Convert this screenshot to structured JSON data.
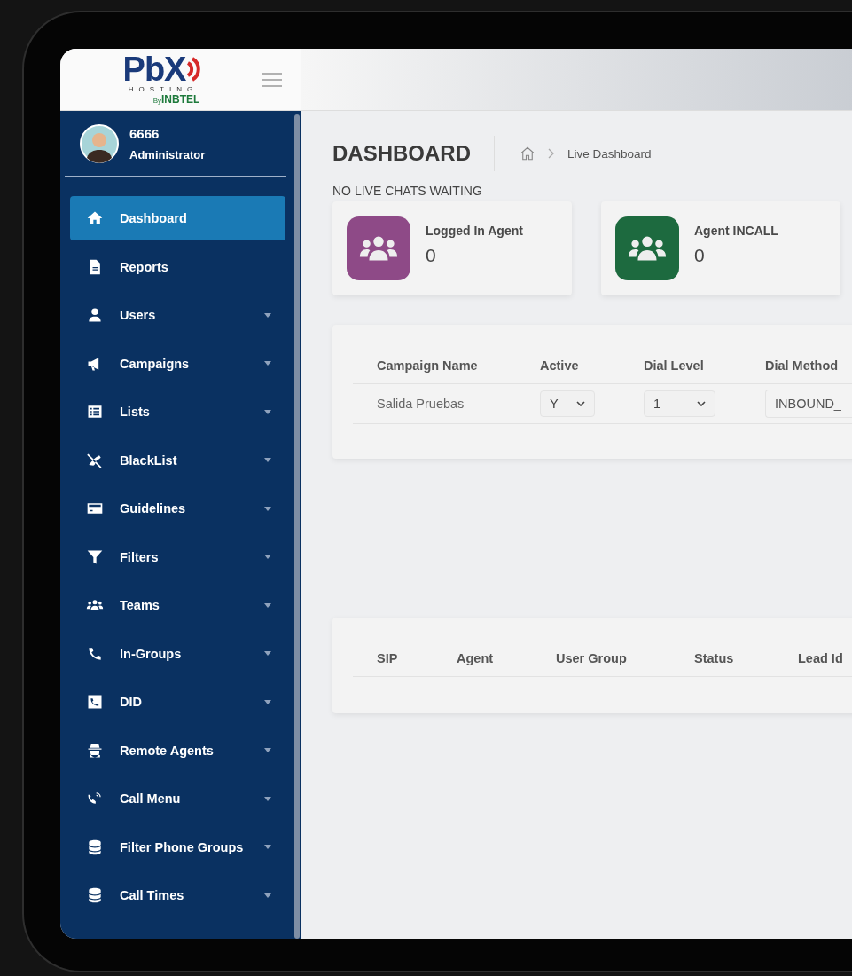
{
  "logo": {
    "main": "PbX",
    "sub": "HOSTING",
    "by": "By",
    "brand": "INBTEL"
  },
  "profile": {
    "name": "6666",
    "role": "Administrator"
  },
  "sidebar": {
    "items": [
      {
        "label": "Dashboard",
        "selected": true,
        "has_submenu": false
      },
      {
        "label": "Reports",
        "selected": false,
        "has_submenu": false
      },
      {
        "label": "Users",
        "selected": false,
        "has_submenu": true
      },
      {
        "label": "Campaigns",
        "selected": false,
        "has_submenu": true
      },
      {
        "label": "Lists",
        "selected": false,
        "has_submenu": true
      },
      {
        "label": "BlackList",
        "selected": false,
        "has_submenu": true
      },
      {
        "label": "Guidelines",
        "selected": false,
        "has_submenu": true
      },
      {
        "label": "Filters",
        "selected": false,
        "has_submenu": true
      },
      {
        "label": "Teams",
        "selected": false,
        "has_submenu": true
      },
      {
        "label": "In-Groups",
        "selected": false,
        "has_submenu": true
      },
      {
        "label": "DID",
        "selected": false,
        "has_submenu": true
      },
      {
        "label": "Remote Agents",
        "selected": false,
        "has_submenu": true
      },
      {
        "label": "Call Menu",
        "selected": false,
        "has_submenu": true
      },
      {
        "label": "Filter Phone Groups",
        "selected": false,
        "has_submenu": true
      },
      {
        "label": "Call Times",
        "selected": false,
        "has_submenu": true
      }
    ]
  },
  "page": {
    "title": "DASHBOARD",
    "breadcrumb": "Live Dashboard",
    "notice": "NO LIVE CHATS WAITING"
  },
  "stats": [
    {
      "label": "Logged In Agent",
      "value": "0",
      "color": "#8e4a87"
    },
    {
      "label": "Agent INCALL",
      "value": "0",
      "color": "#1d6a3f"
    }
  ],
  "campaigns_table": {
    "columns": [
      "Campaign Name",
      "Active",
      "Dial Level",
      "Dial Method"
    ],
    "rows": [
      {
        "name": "Salida Pruebas",
        "active": "Y",
        "dial_level": "1",
        "dial_method": "INBOUND_"
      }
    ]
  },
  "agents_table": {
    "columns": [
      "SIP",
      "Agent",
      "User Group",
      "Status",
      "Lead Id"
    ]
  }
}
